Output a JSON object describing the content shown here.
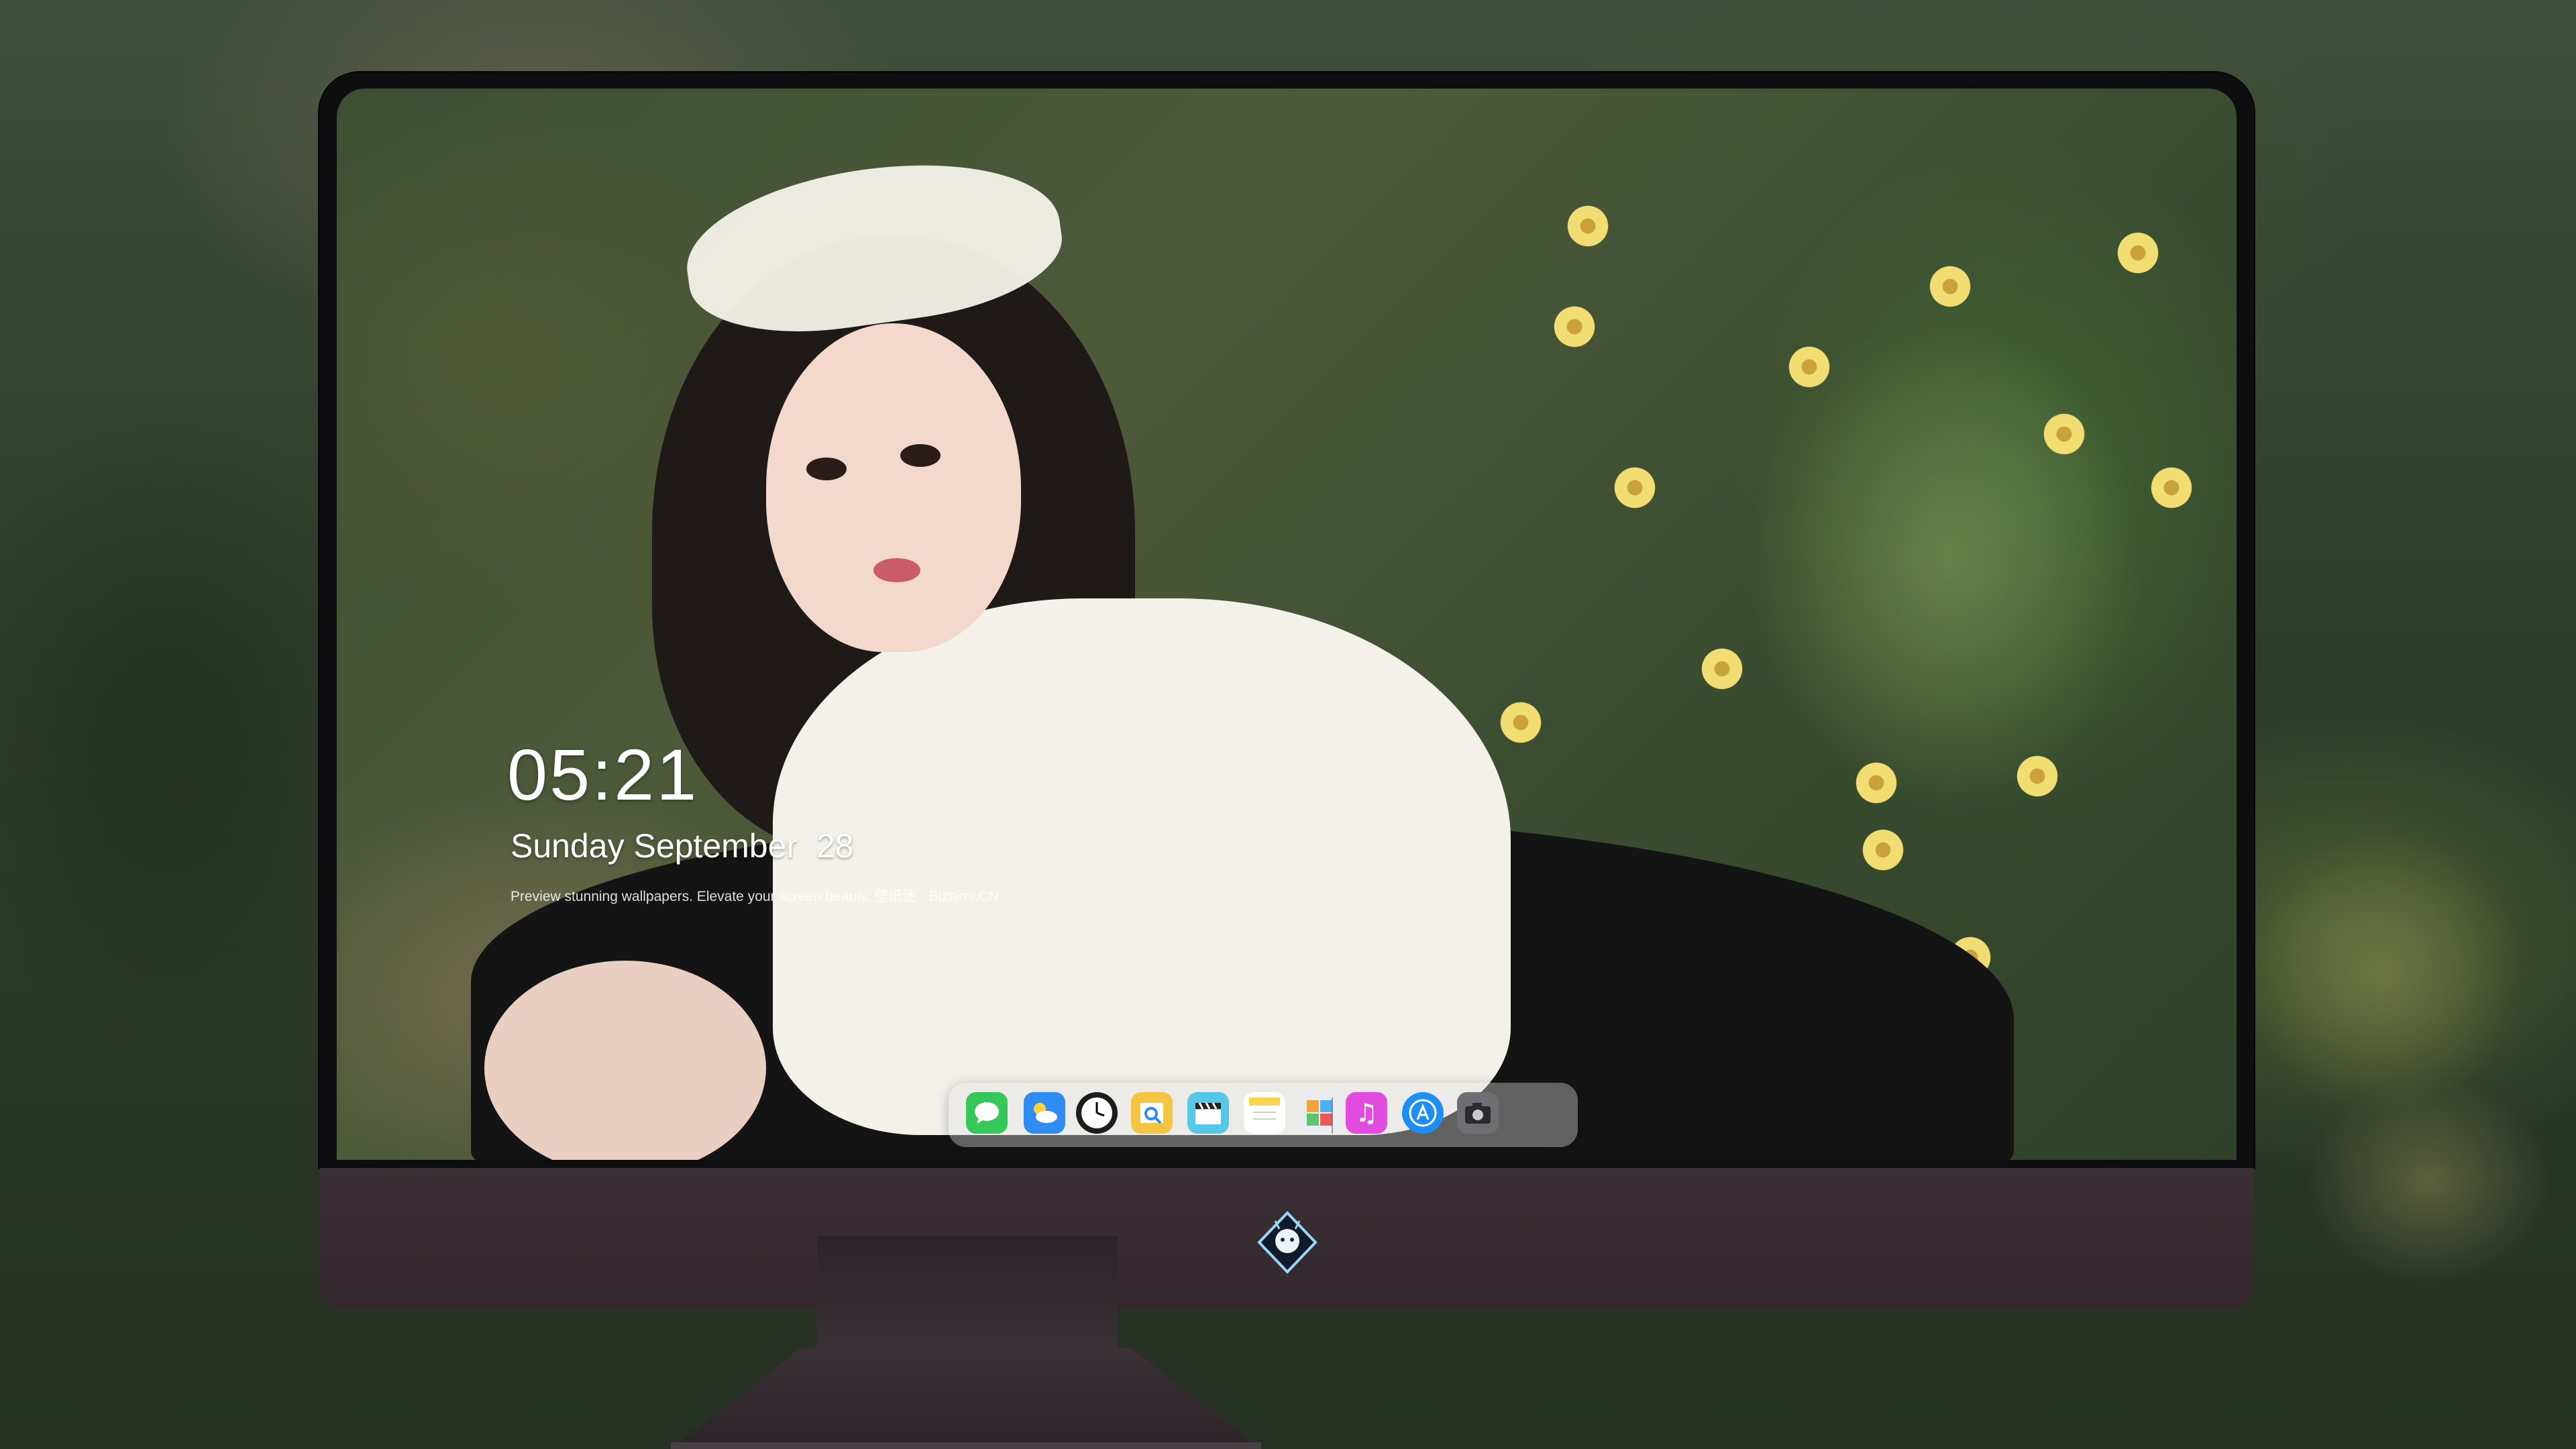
{
  "lockscreen": {
    "time": "05:21",
    "date": "Sunday September  28",
    "tagline": "Preview stunning wallpapers. Elevate your screen beauty. 壁纸迷 · Bizhimi.CN"
  },
  "dock": {
    "apps": [
      {
        "name": "messages-icon",
        "color": "#34c759"
      },
      {
        "name": "weather-icon",
        "color": "#2f8cf0"
      },
      {
        "name": "clock-icon",
        "color": "#1c1c1e"
      },
      {
        "name": "preview-icon",
        "color": "#f4c542"
      },
      {
        "name": "clapperboard-icon",
        "color": "#55c8e8"
      },
      {
        "name": "notes-icon",
        "color": "#f8d44a"
      },
      {
        "name": "photo-gallery-icon",
        "color": "#e9edf2"
      },
      {
        "name": "itunes-icon",
        "color": "#e14be0"
      },
      {
        "name": "app-store-icon",
        "color": "#1e8ef7"
      },
      {
        "name": "camera-icon",
        "color": "#6f6f73"
      }
    ]
  },
  "colors": {
    "bezel": "#0e0e10",
    "chin": "#3b2f36",
    "text": "#ffffff"
  }
}
